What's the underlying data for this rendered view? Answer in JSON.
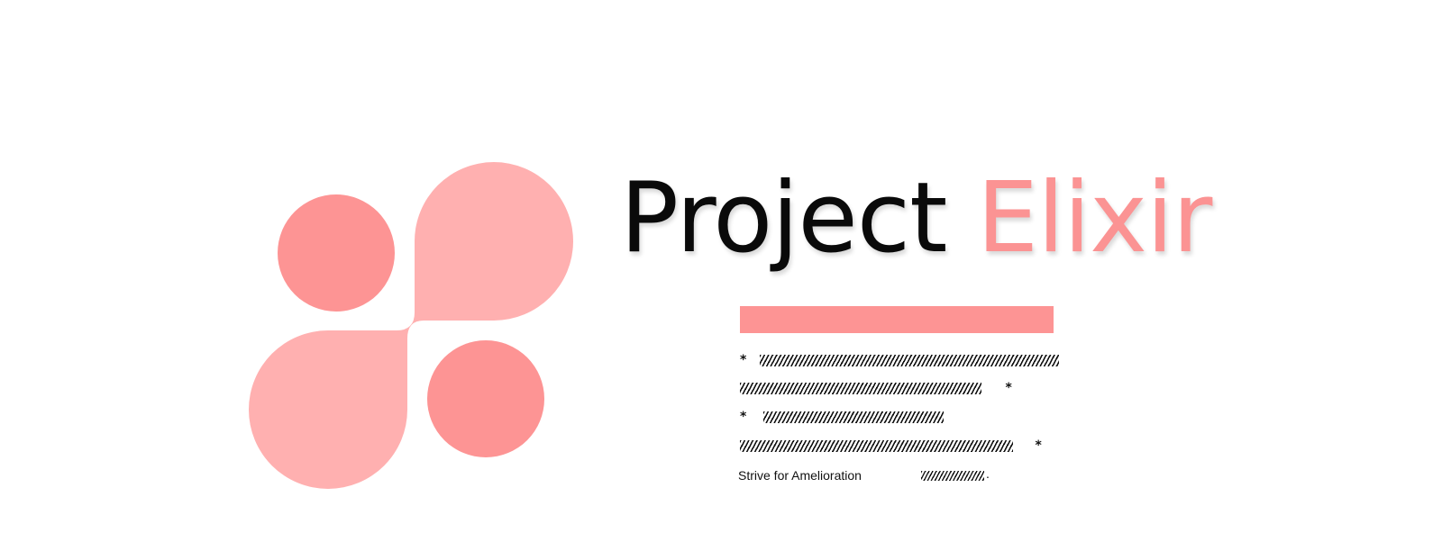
{
  "brand": {
    "title_part1": "Project",
    "title_part2": "Elixir",
    "colors": {
      "primary_pink": "#fd9494",
      "light_pink": "#ffb0b0",
      "title_dark": "#0a0a0a"
    }
  },
  "logo": {
    "icon_name": "elixir-logo-icon"
  },
  "body": {
    "line1_star": "*",
    "line1_redacted": "//////////////////////////////////////////////////////////////////",
    "line2_redacted": "/////////////////////////////////////////////////////",
    "line2_star": "*",
    "line3_star": "*",
    "line3_redacted": "////////////////////////////////////////",
    "line4_redacted": "//////////////////////////////////////////////////////////////",
    "line4_star": "*",
    "tagline": "Strive for Amelioration",
    "tagline_redacted": "////////////////////",
    "tagline_end": "."
  }
}
